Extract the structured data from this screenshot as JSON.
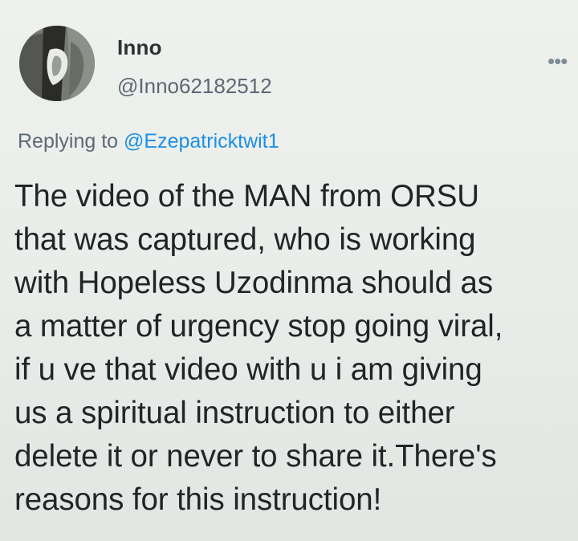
{
  "tweet": {
    "author_name": "Inno",
    "author_handle": "@Inno62182512",
    "more_icon": "more-horizontal-icon",
    "replying_prefix": "Replying to ",
    "replying_mention": "@Ezepatricktwit1",
    "body_lines": [
      "The video of the MAN from ORSU",
      "that was captured, who is working",
      "with Hopeless Uzodinma should as",
      "a matter of urgency stop going viral,",
      "if u ve that video with u i am giving",
      "us a spiritual instruction to either",
      "delete it or never to share it.There's",
      "reasons for this instruction!"
    ]
  },
  "colors": {
    "background": "#eef1ee",
    "name_text": "#2f3134",
    "secondary_text": "#5d6873",
    "mention_blue": "#1d8fe6",
    "body_text": "#222426"
  }
}
